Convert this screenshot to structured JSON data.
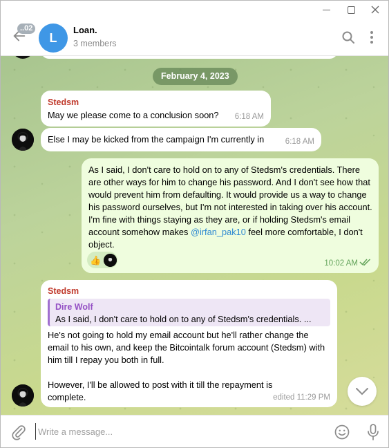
{
  "window": {
    "controls": [
      "minimize",
      "maximize",
      "close"
    ]
  },
  "header": {
    "unread_badge": "..02",
    "avatar_letter": "L",
    "title": "Loan.",
    "subtitle": "3 members",
    "icons": [
      "back-arrow-icon",
      "search-icon",
      "more-vertical-icon"
    ]
  },
  "chat": {
    "date_separator": "February 4, 2023",
    "messages": [
      {
        "sender": "Stedsm",
        "text": "May we please come to a conclusion soon?",
        "time": "6:18 AM"
      },
      {
        "text": "Else I may be kicked from the campaign I'm currently in",
        "time": "6:18 AM"
      },
      {
        "outgoing": true,
        "text_before_mention": "As I said, I don't care to hold on to any of Stedsm's credentials.  There are other ways for him to change his password.  And I don't see how that would prevent him from defaulting.  It would provide us a way to change his password ourselves, but I'm not interested in taking over his account.  I'm fine with things staying as they are, or if holding Stedsm's email account somehow makes ",
        "mention": "@irfan_pak10",
        "text_after_mention": " feel more comfortable, I don't object.",
        "reactions": [
          "👍"
        ],
        "time": "10:02 AM",
        "status": "read"
      },
      {
        "sender": "Stedsm",
        "reply_to": {
          "author": "Dire Wolf",
          "text": "As I said, I don't care to hold on to any of Stedsm's credentials.  ..."
        },
        "text": "He's not going to hold my email account but he'll rather change the email to his own, and keep the Bitcointalk forum account (Stedsm) with him till I repay you both in full.",
        "text2": "However, I'll be allowed to post with it till the repayment is complete.",
        "time": "edited 11:29 PM"
      }
    ]
  },
  "composer": {
    "placeholder": "Write a message...",
    "icons": [
      "paperclip-icon",
      "emoji-icon",
      "microphone-icon"
    ]
  }
}
